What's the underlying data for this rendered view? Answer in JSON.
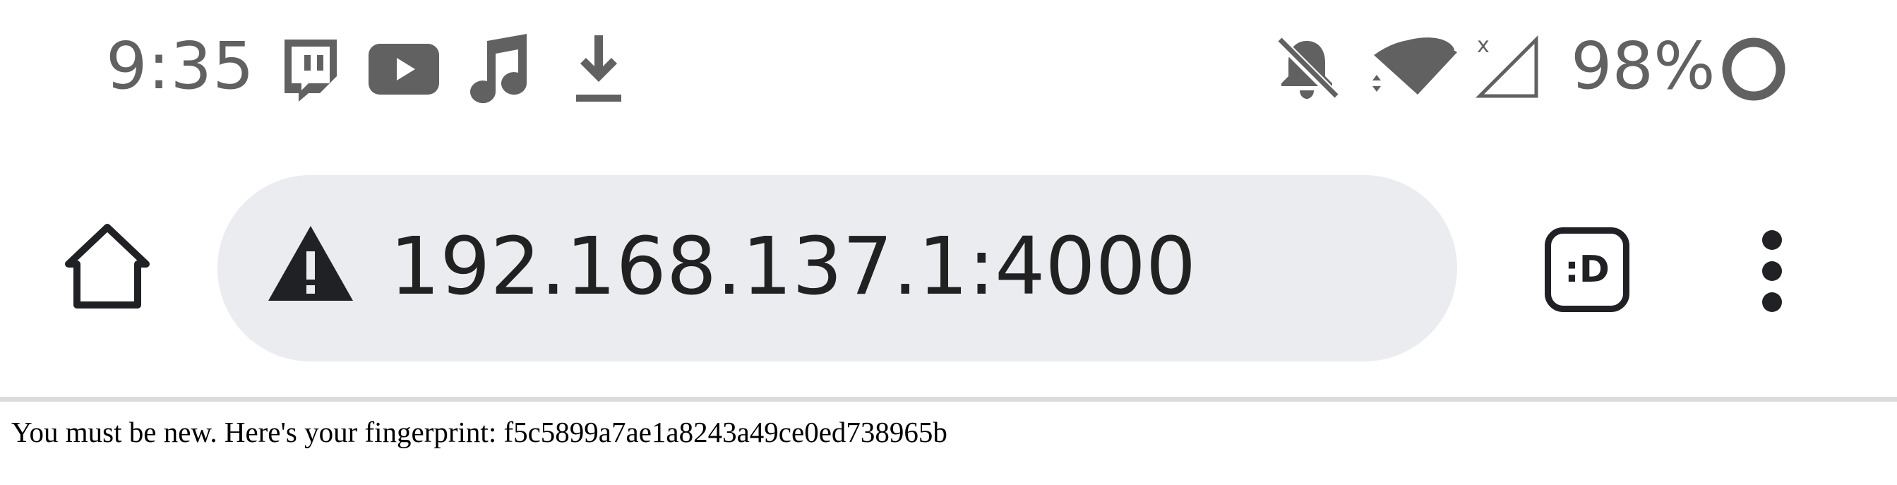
{
  "status_bar": {
    "time": "9:35",
    "notification_icons": [
      "twitch-icon",
      "youtube-icon",
      "music-note-icon",
      "download-icon"
    ],
    "system_icons": [
      "notifications-muted-icon",
      "wifi-icon",
      "no-signal-icon",
      "battery-icon"
    ],
    "battery_percent": "98%"
  },
  "toolbar": {
    "home_icon": "home-icon",
    "security_icon": "warning-icon",
    "url": "192.168.137.1:4000",
    "extension_label": ":D",
    "menu_icon": "more-vert-icon"
  },
  "page": {
    "message": "You must be new. Here's your fingerprint: f5c5899a7ae1a8243a49ce0ed738965b"
  },
  "colors": {
    "status_icon": "#616161",
    "omnibox_bg": "#ebecf0",
    "toolbar_icon": "#202124",
    "divider": "#dadce0"
  }
}
